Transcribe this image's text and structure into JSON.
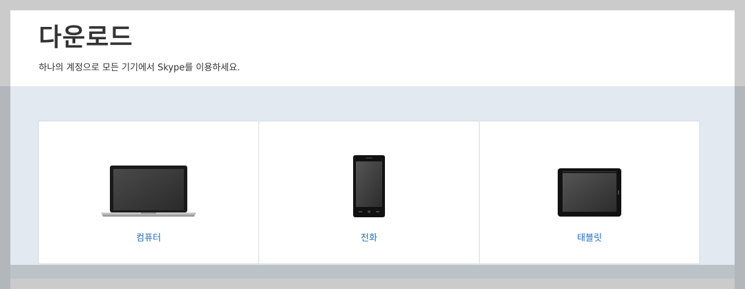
{
  "header": {
    "title": "다운로드",
    "subtitle": "하나의 계정으로 모든 기기에서 Skype를 이용하세요."
  },
  "devices": [
    {
      "label": "컴퓨터",
      "icon": "laptop-icon"
    },
    {
      "label": "전화",
      "icon": "phone-icon"
    },
    {
      "label": "태블릿",
      "icon": "tablet-icon"
    }
  ],
  "colors": {
    "accent": "#1f6fbf",
    "band": "#e3e9f0",
    "title": "#333333"
  }
}
